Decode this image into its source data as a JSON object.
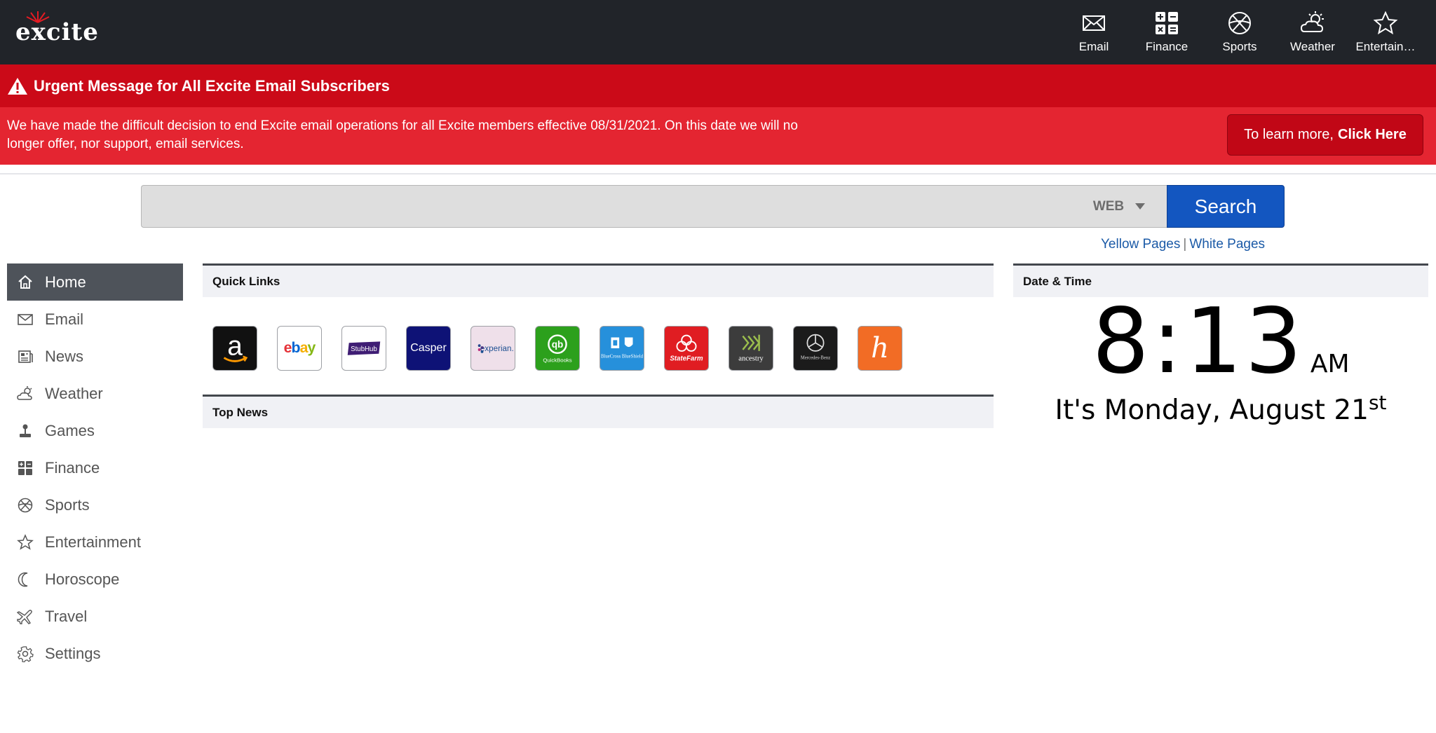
{
  "app": {
    "logo_text": "excite"
  },
  "topnav": [
    {
      "id": "email",
      "label": "Email",
      "icon": "envelope-icon"
    },
    {
      "id": "finance",
      "label": "Finance",
      "icon": "calculator-icon"
    },
    {
      "id": "sports",
      "label": "Sports",
      "icon": "basketball-icon"
    },
    {
      "id": "weather",
      "label": "Weather",
      "icon": "cloud-sun-icon"
    },
    {
      "id": "entertainment",
      "label": "Entertain…",
      "icon": "star-icon"
    }
  ],
  "alert": {
    "title": "Urgent Message for All Excite Email Subscribers",
    "body": "We have made the difficult decision to end Excite email operations for all Excite members effective 08/31/2021. On this date we will no longer offer, nor support, email services.",
    "button_prefix": "To learn more,",
    "button_bold": "Click Here"
  },
  "search": {
    "value": "",
    "placeholder": "",
    "type": "WEB",
    "button_label": "Search"
  },
  "directory": {
    "yellow": "Yellow Pages",
    "separator": "|",
    "white": "White Pages"
  },
  "sidebar": {
    "items": [
      {
        "label": "Home",
        "icon": "home-icon",
        "active": true
      },
      {
        "label": "Email",
        "icon": "envelope-icon"
      },
      {
        "label": "News",
        "icon": "newspaper-icon"
      },
      {
        "label": "Weather",
        "icon": "cloud-sun-icon"
      },
      {
        "label": "Games",
        "icon": "joystick-icon"
      },
      {
        "label": "Finance",
        "icon": "calculator-icon"
      },
      {
        "label": "Sports",
        "icon": "basketball-icon"
      },
      {
        "label": "Entertainment",
        "icon": "star-icon"
      },
      {
        "label": "Horoscope",
        "icon": "moon-icon"
      },
      {
        "label": "Travel",
        "icon": "plane-icon"
      },
      {
        "label": "Settings",
        "icon": "gear-icon"
      }
    ]
  },
  "panels": {
    "quick_links_title": "Quick Links",
    "top_news_title": "Top News",
    "date_time_title": "Date & Time"
  },
  "quick_links": [
    {
      "name": "amazon",
      "label": "a",
      "bg": "#111111",
      "fg": "#ffffff"
    },
    {
      "name": "ebay",
      "label": "ebay",
      "bg": "#ffffff",
      "fg": "#e53238"
    },
    {
      "name": "stubhub",
      "label": "StubHub",
      "bg": "#ffffff",
      "fg": "#ffffff"
    },
    {
      "name": "casper",
      "label": "Casper",
      "bg": "#0e1276",
      "fg": "#ffffff"
    },
    {
      "name": "experian",
      "label": "experian.",
      "bg": "#efe0ea",
      "fg": "#1d4f91"
    },
    {
      "name": "quickbooks",
      "label": "QuickBooks",
      "bg": "#2ca01c",
      "fg": "#ffffff"
    },
    {
      "name": "bluecross",
      "label": "BlueCross BlueShield",
      "bg": "#2690db",
      "fg": "#ffffff"
    },
    {
      "name": "statefarm",
      "label": "StateFarm",
      "bg": "#e01d22",
      "fg": "#ffffff"
    },
    {
      "name": "ancestry",
      "label": "ancestry",
      "bg": "#3c3c3c",
      "fg": "#ffffff"
    },
    {
      "name": "mercedes",
      "label": "Mercedes-Benz",
      "bg": "#1b1b1b",
      "fg": "#ffffff"
    },
    {
      "name": "honey",
      "label": "h",
      "bg": "#f26c25",
      "fg": "#ffffff"
    }
  ],
  "clock": {
    "time": "8:13",
    "ampm": "AM",
    "date_prefix": "It's Monday, August 21",
    "date_suffix": "st"
  },
  "colors": {
    "topbar": "#212429",
    "alert_dark": "#cb0a18",
    "alert_light": "#e42531",
    "search_button": "#1356c0",
    "link": "#1b5aa7",
    "sidebar_active": "#4e535a"
  }
}
